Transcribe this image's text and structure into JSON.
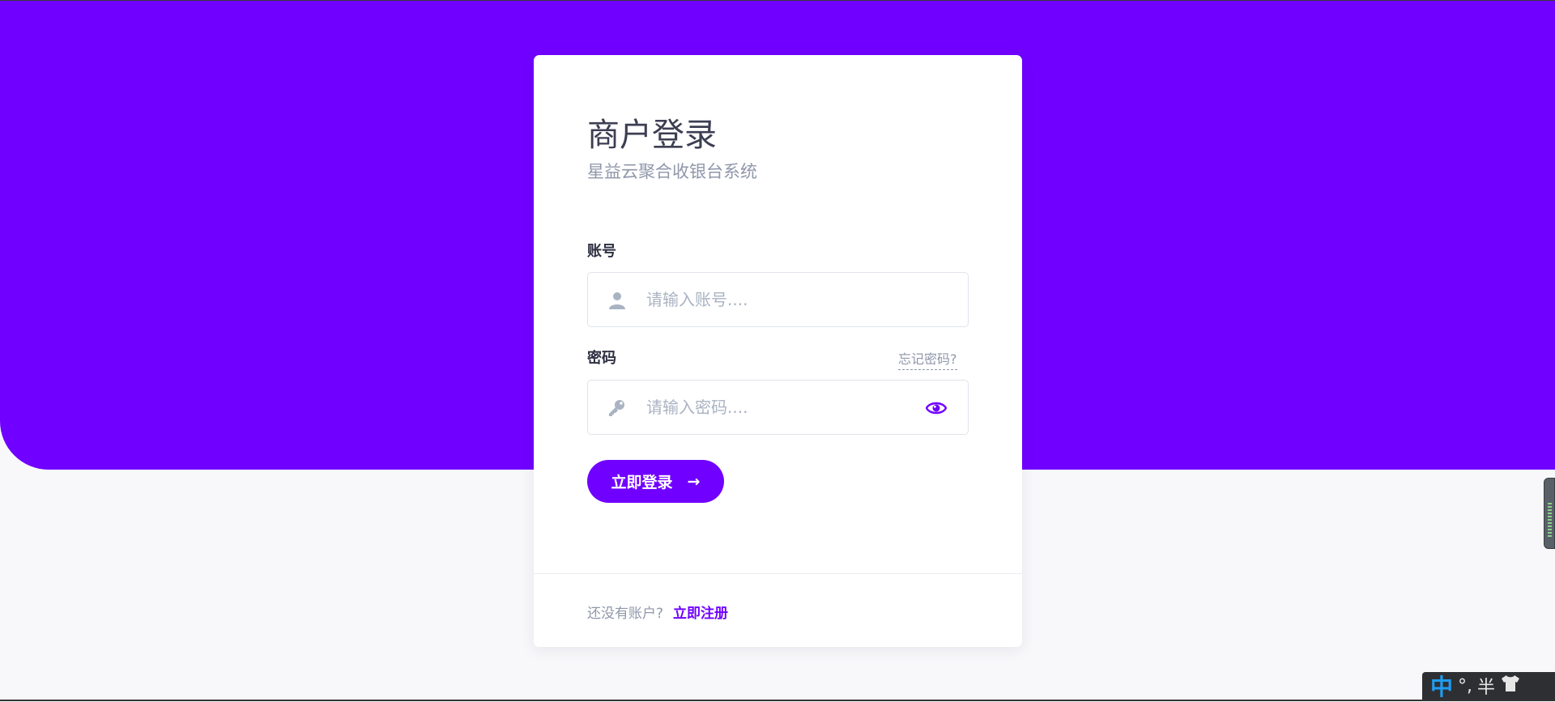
{
  "login": {
    "title": "商户登录",
    "subtitle": "星益云聚合收银台系统",
    "account_label": "账号",
    "account_placeholder": "请输入账号....",
    "password_label": "密码",
    "forgot_link": "忘记密码?",
    "password_placeholder": "请输入密码....",
    "submit_label": "立即登录",
    "submit_arrow": "→"
  },
  "footer": {
    "question": "还没有账户?",
    "register_link": "立即注册"
  },
  "ime": {
    "mode": "中",
    "punct": "°,",
    "width": "半"
  },
  "colors": {
    "brand": "#7000ff",
    "muted": "#8f97aa",
    "icon": "#aab3c2"
  },
  "icons": {
    "account_field": "user-icon",
    "password_field": "key-icon",
    "password_toggle": "eye-icon",
    "submit": "arrow-right-icon",
    "ime_skin": "shirt-icon"
  }
}
